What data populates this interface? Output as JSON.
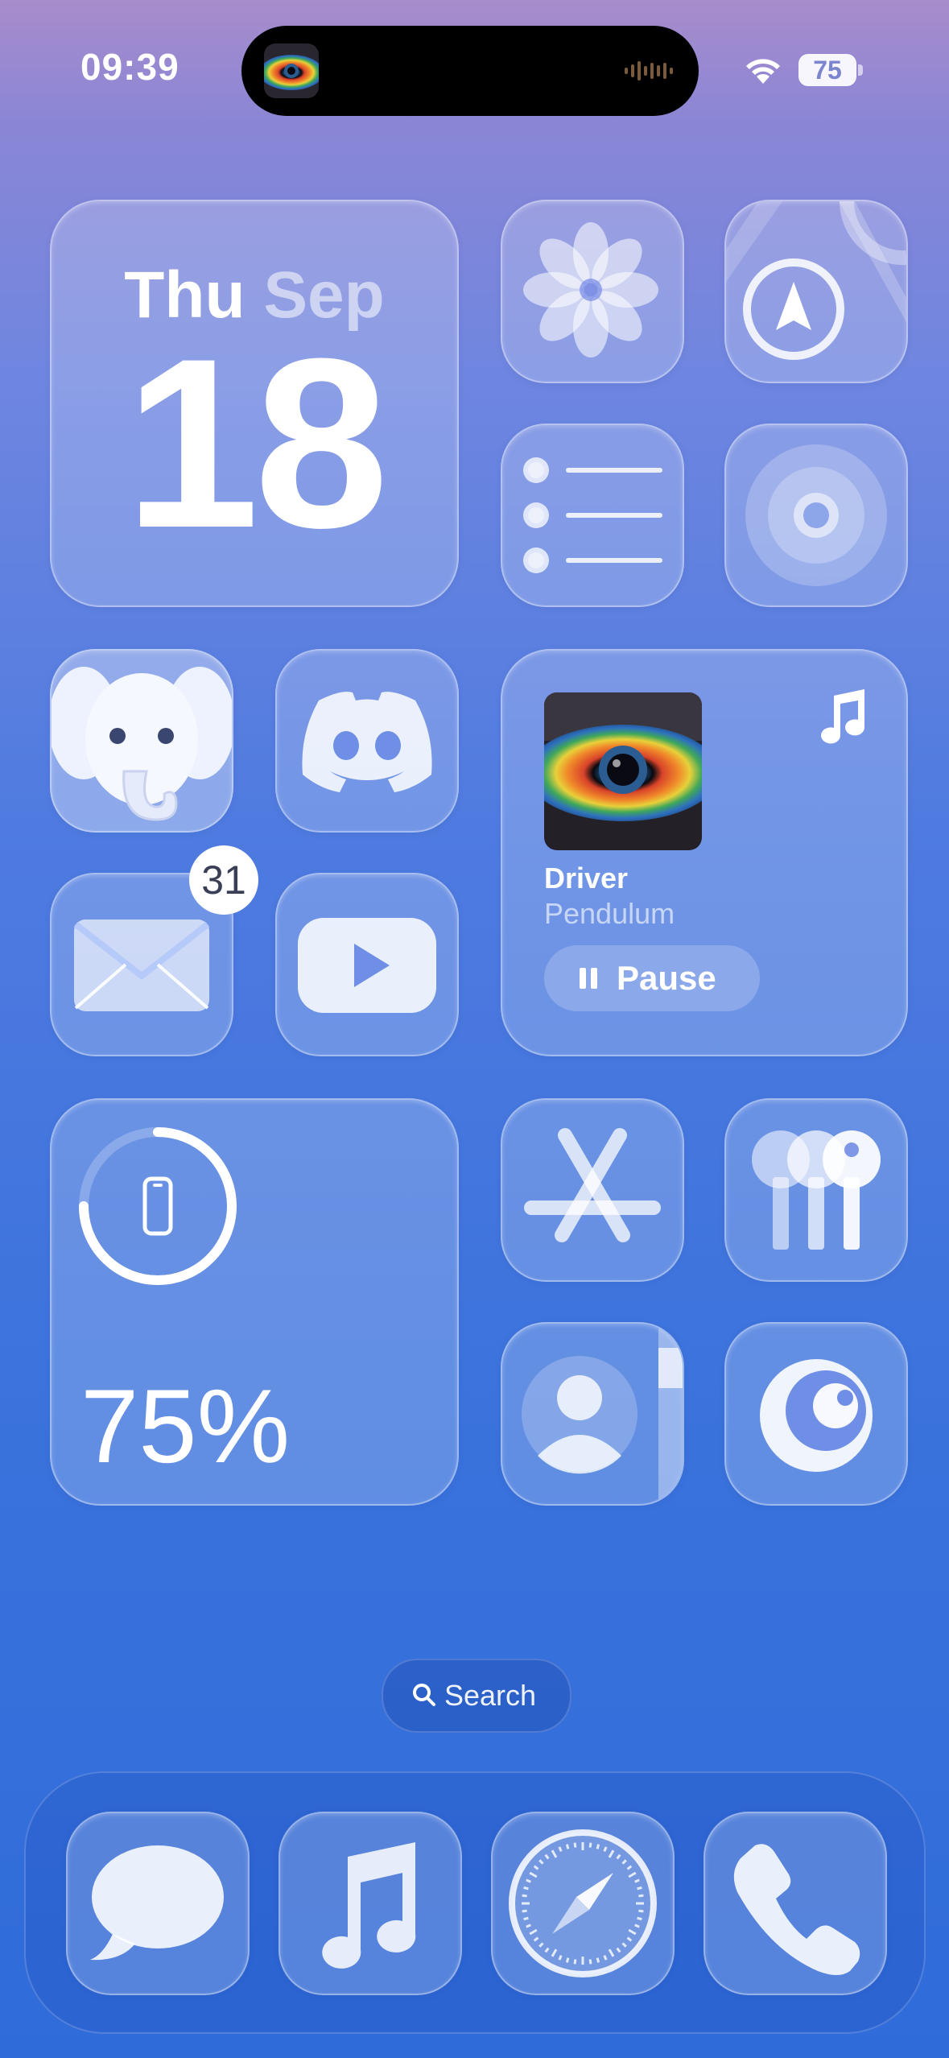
{
  "status_bar": {
    "time": "09:39",
    "battery_level": "75",
    "wifi_icon": "wifi-icon"
  },
  "calendar_widget": {
    "weekday": "Thu",
    "month": "Sep",
    "day": "18"
  },
  "apps": {
    "photos": "photos-icon",
    "maps": "maps-icon",
    "reminders": "reminders-icon",
    "find_my": "find-my-icon",
    "mastodon": "elephant-icon",
    "discord": "discord-icon",
    "mail": "mail-icon",
    "youtube": "play-icon",
    "app_store": "app-store-icon",
    "passwords": "keys-icon",
    "contacts": "contacts-icon",
    "crunchyroll": "crunchyroll-icon"
  },
  "mail_badge": "31",
  "now_playing": {
    "song": "Driver",
    "artist": "Pendulum",
    "pause_label": "Pause",
    "is_playing": true
  },
  "battery_widget": {
    "percent_label": "75%",
    "level": 0.75
  },
  "search_label": "Search",
  "dock": [
    "messages-icon",
    "music-icon",
    "safari-icon",
    "phone-icon"
  ],
  "colors": {
    "bg_top": "#a88ccb",
    "bg_bottom": "#2f6cda",
    "glass": "rgba(255,255,255,0.20)"
  }
}
